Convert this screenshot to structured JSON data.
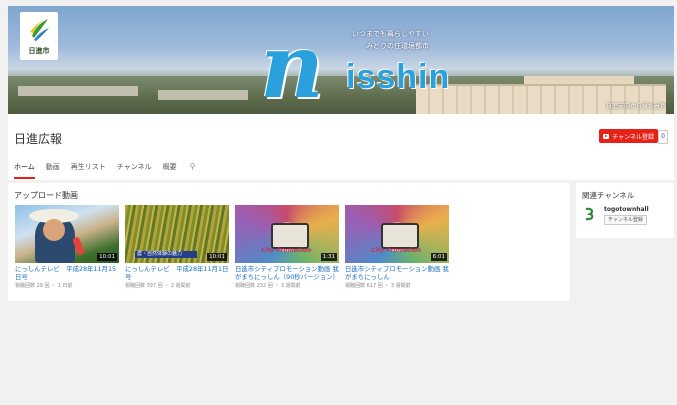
{
  "banner": {
    "logo_text": "日進市",
    "brand_first": "n",
    "brand_rest": "isshin",
    "tagline_line1": "いつまでも暮らしやすい",
    "tagline_line2": "みどりの住環境都市",
    "watermark": "日進市内から見た景色"
  },
  "channel": {
    "title": "日進広報",
    "subscribe_label": "チャンネル登録",
    "subscriber_count": "0"
  },
  "tabs": [
    {
      "label": "ホーム"
    },
    {
      "label": "動画"
    },
    {
      "label": "再生リスト"
    },
    {
      "label": "チャンネル"
    },
    {
      "label": "概要"
    }
  ],
  "uploads": {
    "section_title": "アップロード動画",
    "videos": [
      {
        "title": "にっしんテレビ　平成28年11月15日号",
        "meta": "視聴回数 29 回 ・ 1 日前",
        "duration": "10:01"
      },
      {
        "title": "にっしんテレビ　平成28年11月1日号",
        "meta": "視聴回数 397 回 ・ 2 週間前",
        "duration": "10:01",
        "caption": "農・自然体験の魅力"
      },
      {
        "title": "日進市シティプロモーション動画 我がまちにっしん（90秒バージョン）",
        "meta": "視聴回数 232 回 ・ 3 週間前",
        "duration": "1:31",
        "caption": "City Promotion"
      },
      {
        "title": "日進市シティプロモーション動画 我がまちにっしん",
        "meta": "視聴回数 617 回 ・ 3 週間前",
        "duration": "6:01",
        "caption": "City Promotion"
      }
    ]
  },
  "related": {
    "title": "関連チャンネル",
    "channel_name": "togotownhall",
    "subscribe_label": "チャンネル登録"
  },
  "colors": {
    "brand_blue": "#2aa0dc",
    "subscribe_red": "#e62117",
    "link_blue": "#1a6fc2"
  }
}
